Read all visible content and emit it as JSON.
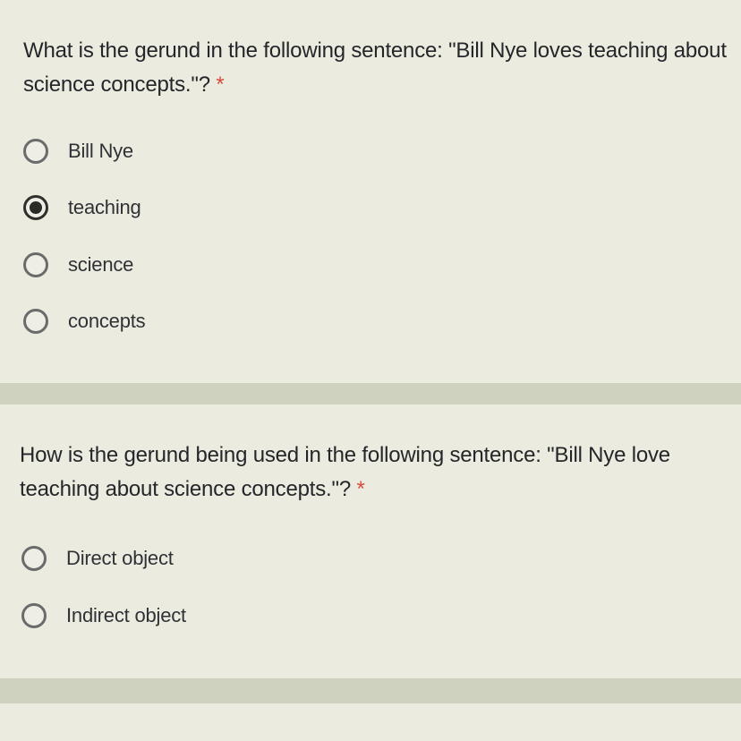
{
  "questions": [
    {
      "text": "What is the gerund in the following sentence: \"Bill Nye loves teaching about science concepts.\"?",
      "required_mark": "*",
      "options": [
        {
          "label": "Bill Nye",
          "selected": false
        },
        {
          "label": "teaching",
          "selected": true
        },
        {
          "label": "science",
          "selected": false
        },
        {
          "label": "concepts",
          "selected": false
        }
      ]
    },
    {
      "text": "How is the gerund being used in the following sentence: \"Bill Nye loves teaching about science concepts.\"?",
      "required_mark": "*",
      "options": [
        {
          "label": "Direct object",
          "selected": false
        },
        {
          "label": "Indirect object",
          "selected": false
        }
      ]
    }
  ],
  "colors": {
    "background": "#d6d8c8",
    "card": "#ebebdf",
    "required": "#d64b3c",
    "radio_border": "#6a6b6c",
    "radio_checked": "#2b2b25"
  }
}
